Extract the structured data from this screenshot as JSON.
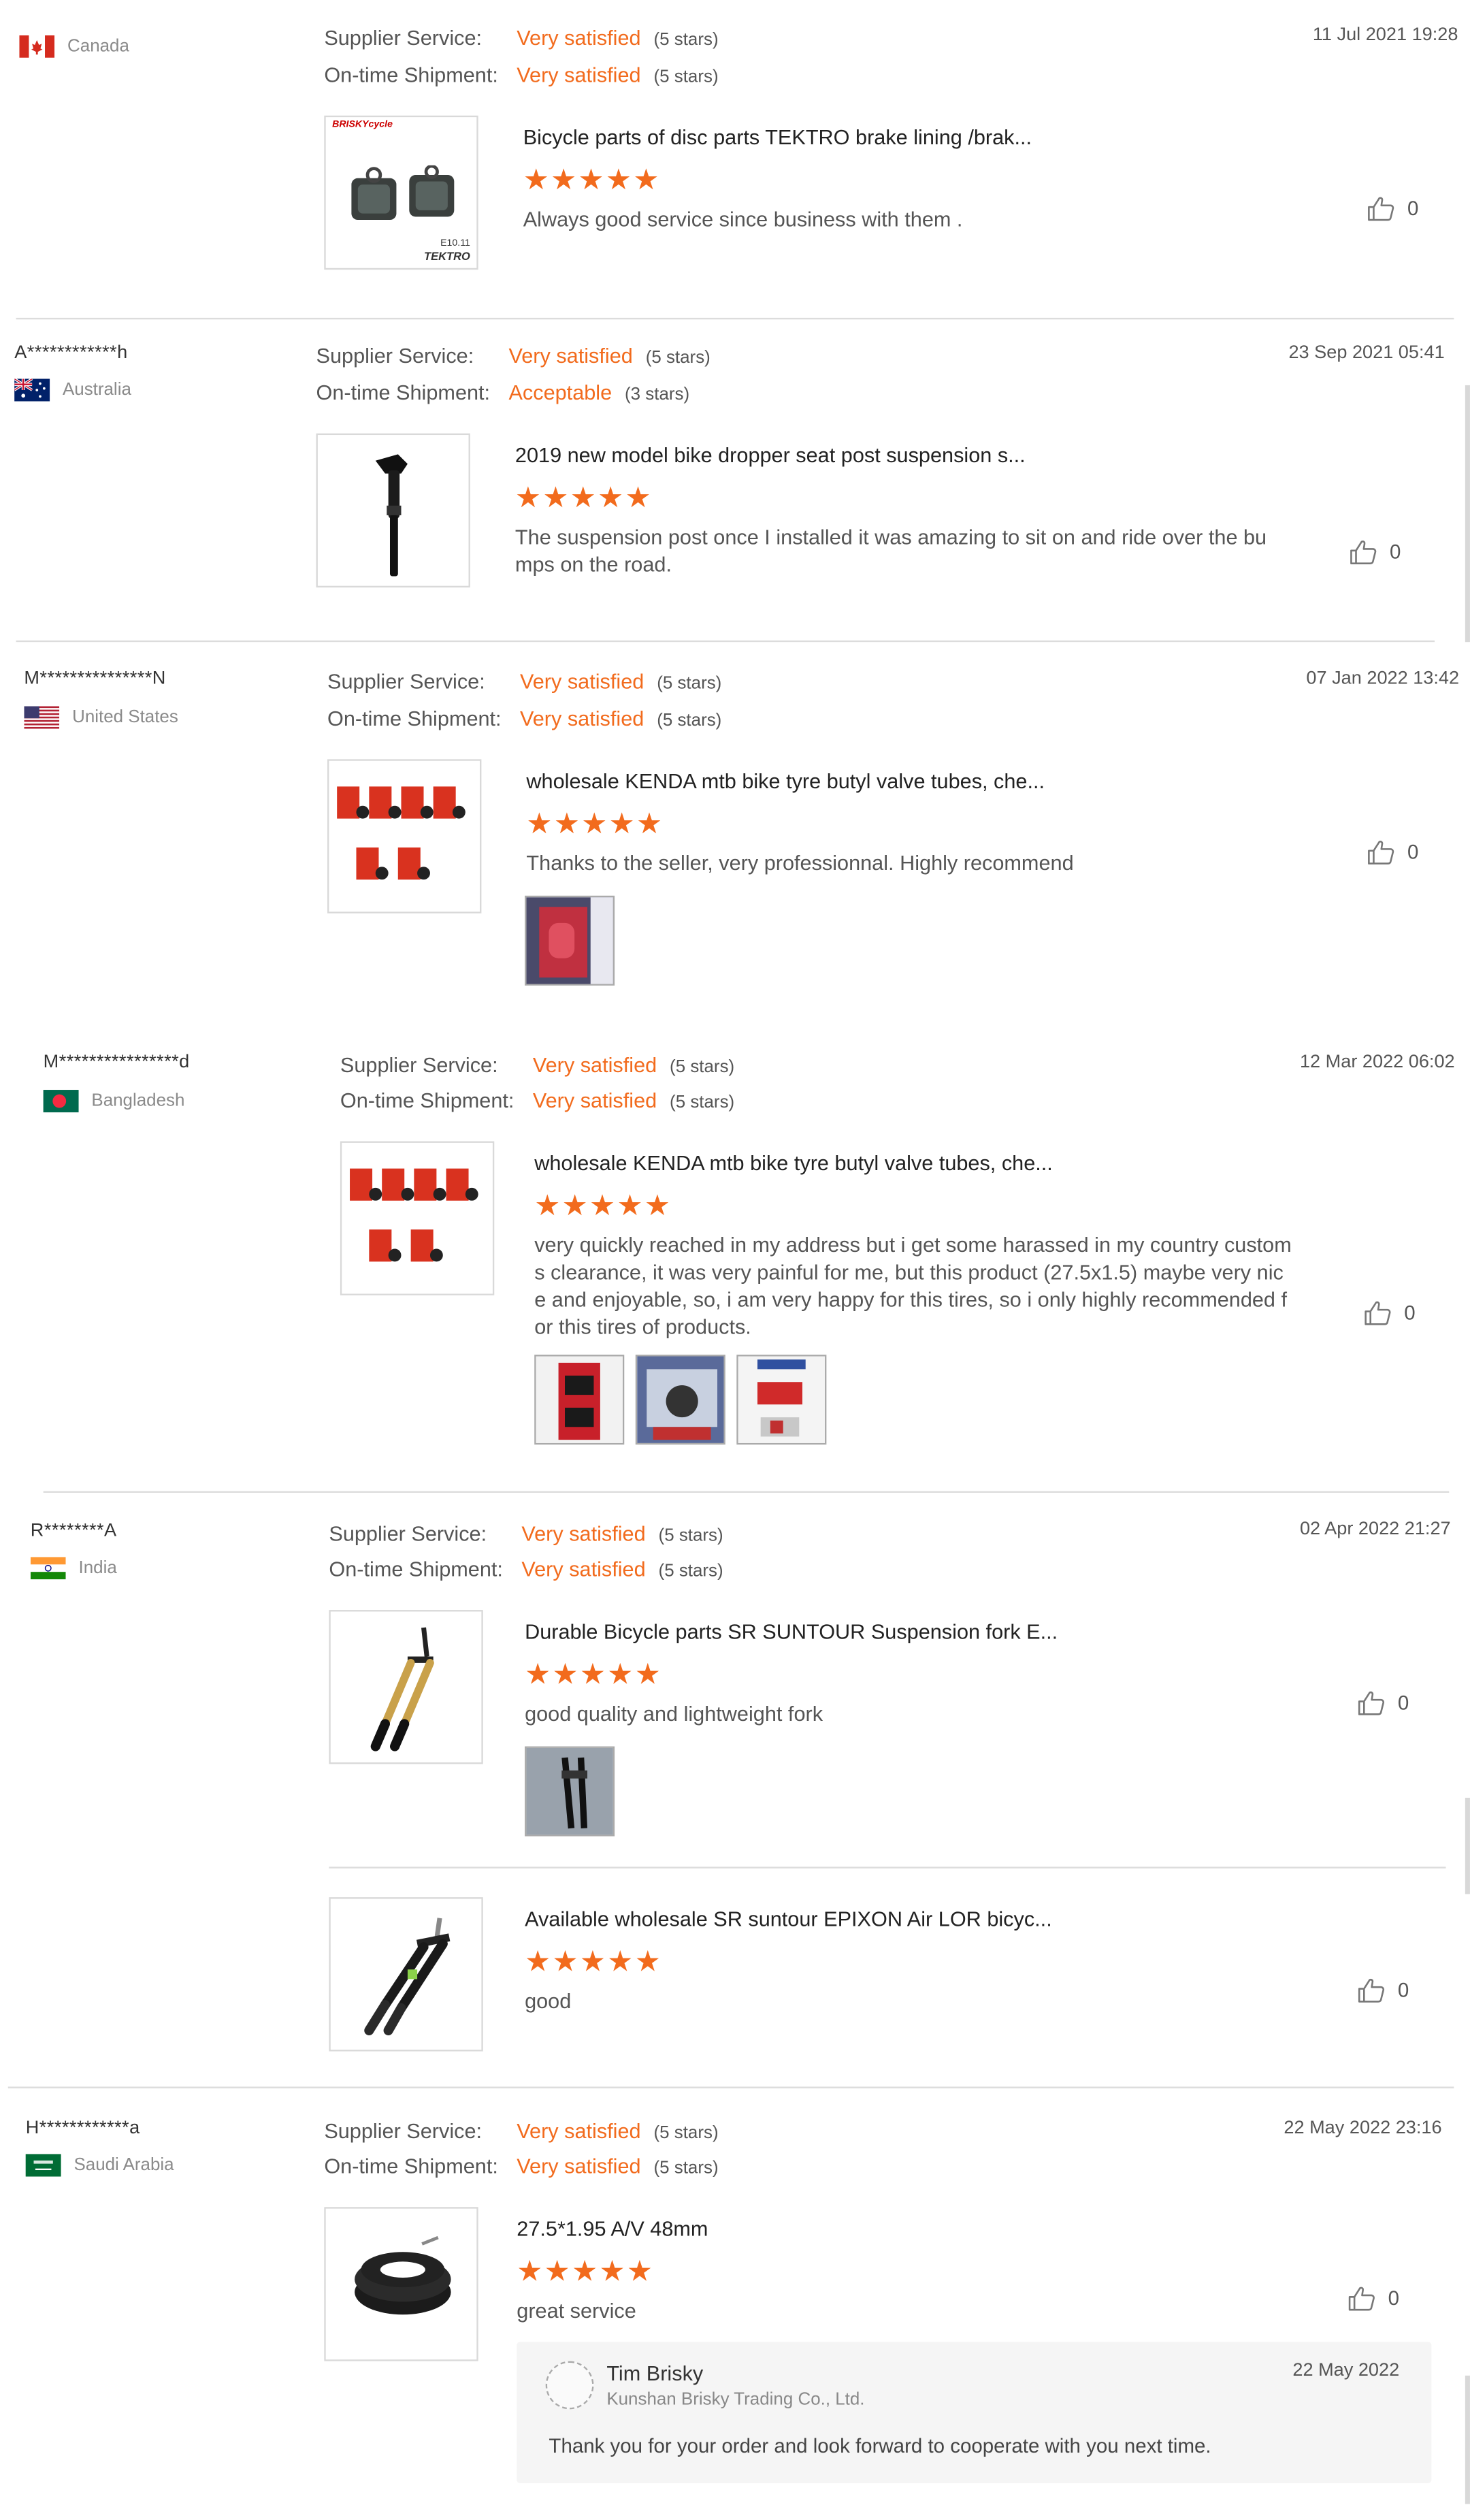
{
  "labels": {
    "supplier_service": "Supplier Service:",
    "ontime_shipment": "On-time Shipment:"
  },
  "reviews": [
    {
      "username": "",
      "country": "Canada",
      "flag_icon": "flag-canada-icon",
      "supplier_service": {
        "value": "Very satisfied",
        "stars": "(5 stars)"
      },
      "ontime_shipment": {
        "value": "Very satisfied",
        "stars": "(5 stars)"
      },
      "date": "11 Jul 2021 19:28",
      "products": [
        {
          "title": "Bicycle parts of disc parts TEKTRO brake lining /brak...",
          "rating": "★★★★★",
          "text": "Always  good service since business with them .",
          "likes": "0",
          "thumb_brand": "BRISKYcycle",
          "thumb_code": "E10.11",
          "thumb_maker": "TEKTRO"
        }
      ]
    },
    {
      "username": "A************h",
      "country": "Australia",
      "flag_icon": "flag-australia-icon",
      "supplier_service": {
        "value": "Very satisfied",
        "stars": "(5 stars)"
      },
      "ontime_shipment": {
        "value": "Acceptable",
        "stars": "(3 stars)"
      },
      "date": "23 Sep 2021 05:41",
      "products": [
        {
          "title": "2019 new model bike dropper seat post suspension s...",
          "rating": "★★★★★",
          "text_lines": [
            "The suspension post once I installed it was amazing to sit on and ride over the bu",
            "mps on the road."
          ],
          "likes": "0"
        }
      ]
    },
    {
      "username": "M***************N",
      "country": "United States",
      "flag_icon": "flag-usa-icon",
      "supplier_service": {
        "value": "Very satisfied",
        "stars": "(5 stars)"
      },
      "ontime_shipment": {
        "value": "Very satisfied",
        "stars": "(5 stars)"
      },
      "date": "07 Jan 2022 13:42",
      "products": [
        {
          "title": "wholesale KENDA mtb bike tyre butyl valve tubes, che...",
          "rating": "★★★★★",
          "text": "Thanks to the seller, very professionnal. Highly recommend",
          "likes": "0"
        }
      ]
    },
    {
      "username": "M****************d",
      "country": "Bangladesh",
      "flag_icon": "flag-bangladesh-icon",
      "supplier_service": {
        "value": "Very satisfied",
        "stars": "(5 stars)"
      },
      "ontime_shipment": {
        "value": "Very satisfied",
        "stars": "(5 stars)"
      },
      "date": "12 Mar 2022 06:02",
      "products": [
        {
          "title": "wholesale KENDA mtb bike tyre butyl valve tubes, che...",
          "rating": "★★★★★",
          "text_lines": [
            "very quickly reached in my address but i get some harassed in my country custom",
            "s clearance,  it was very painful for me, but this product (27.5x1.5) maybe very nic",
            "e and enjoyable, so, i am very happy for this tires, so i only highly recommended f",
            "or this tires of products."
          ],
          "likes": "0"
        }
      ]
    },
    {
      "username": "R********A",
      "country": "India",
      "flag_icon": "flag-india-icon",
      "supplier_service": {
        "value": "Very satisfied",
        "stars": "(5 stars)"
      },
      "ontime_shipment": {
        "value": "Very satisfied",
        "stars": "(5 stars)"
      },
      "date": "02 Apr 2022 21:27",
      "products": [
        {
          "title": "Durable Bicycle parts SR SUNTOUR Suspension fork E...",
          "rating": "★★★★★",
          "text": "good quality and lightweight fork",
          "likes": "0"
        },
        {
          "title": "Available wholesale SR suntour EPIXON Air LOR bicyc...",
          "rating": "★★★★★",
          "text": "good",
          "likes": "0"
        }
      ]
    },
    {
      "username": "H************a",
      "country": "Saudi Arabia",
      "flag_icon": "flag-saudi-arabia-icon",
      "supplier_service": {
        "value": "Very satisfied",
        "stars": "(5 stars)"
      },
      "ontime_shipment": {
        "value": "Very satisfied",
        "stars": "(5 stars)"
      },
      "date": "22 May 2022 23:16",
      "products": [
        {
          "title": "27.5*1.95 A/V 48mm",
          "rating": "★★★★★",
          "text": "great service",
          "likes": "0"
        }
      ],
      "reply": {
        "name": "Tim Brisky",
        "company": "Kunshan Brisky Trading Co., Ltd.",
        "date": "22 May 2022",
        "text": "Thank you for your order and look forward to cooperate with you next time."
      }
    }
  ],
  "colors": {
    "accent": "#f26b1d",
    "text": "#333333",
    "muted": "#8a8a8a",
    "divider": "#dcdcdc",
    "reply_bg": "#f5f5f5"
  }
}
